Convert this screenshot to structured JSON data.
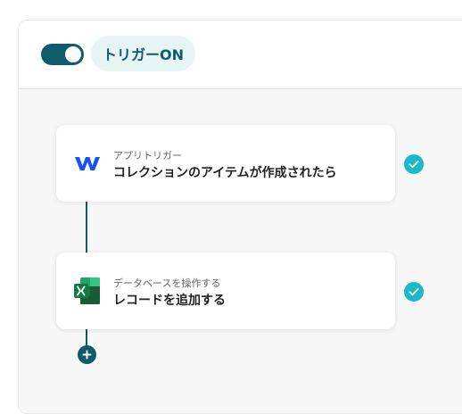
{
  "header": {
    "toggle_state": "on",
    "trigger_label": "トリガーON"
  },
  "flow": {
    "steps": [
      {
        "subtitle": "アプリトリガー",
        "title": "コレクションのアイテムが作成されたら",
        "icon": "webflow-icon",
        "status": "complete"
      },
      {
        "subtitle": "データベースを操作する",
        "title": "レコードを追加する",
        "icon": "excel-icon",
        "status": "complete"
      }
    ]
  },
  "colors": {
    "accent": "#0e5b6b",
    "check": "#18b9c8",
    "badge_bg": "#e6f4f4",
    "canvas_bg": "#f7f7f7"
  }
}
